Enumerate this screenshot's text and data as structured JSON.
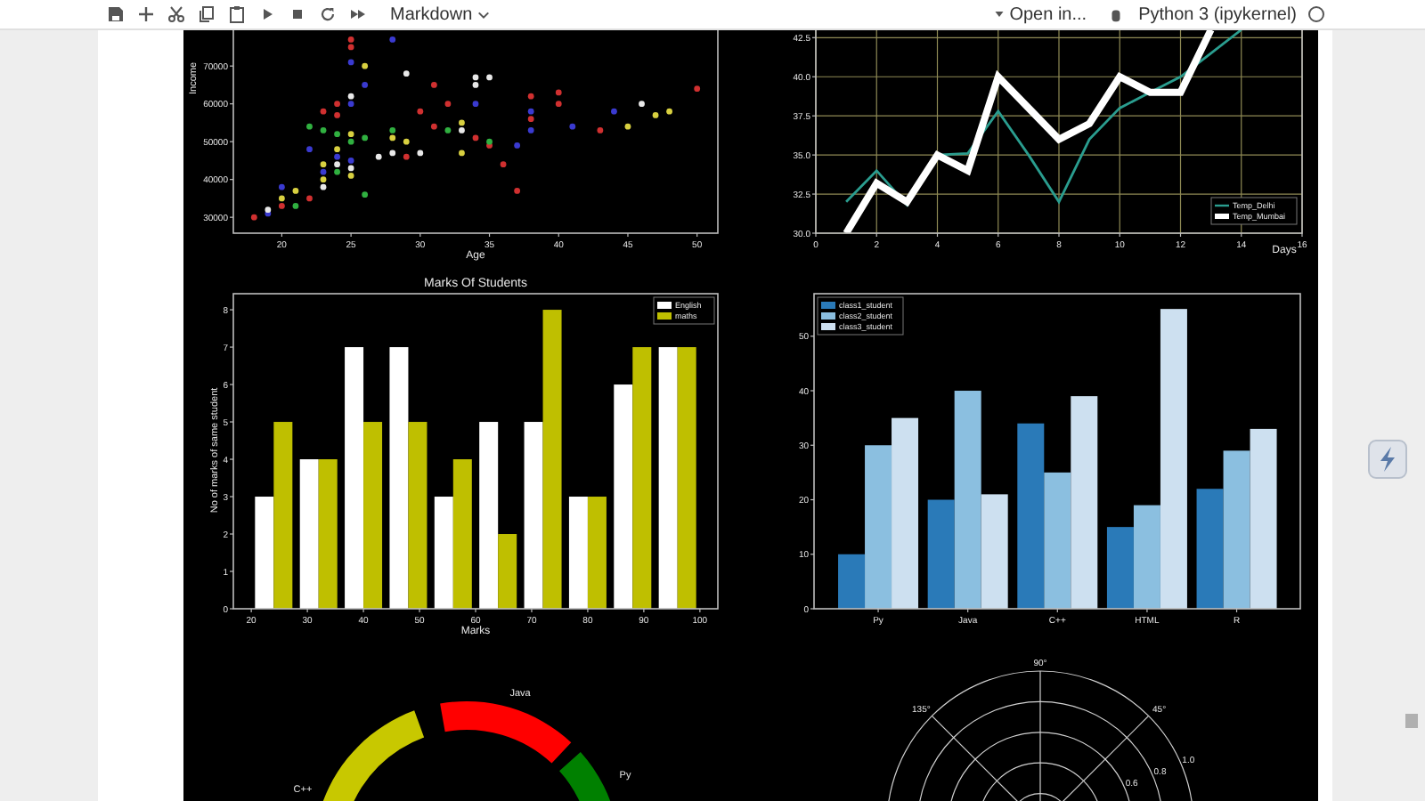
{
  "toolbar": {
    "cell_type": "Markdown",
    "open_in": "Open in...",
    "kernel": "Python 3 (ipykernel)",
    "kernel_busy": false
  },
  "output": {
    "scatter": {
      "chart_data": {
        "type": "scatter",
        "xlabel": "Age",
        "ylabel": "Income",
        "xlim": [
          16.5,
          51.5
        ],
        "ylim": [
          25800,
          80400
        ],
        "xticks": [
          20,
          25,
          30,
          35,
          40,
          45,
          50
        ],
        "yticks": [
          30000,
          40000,
          50000,
          60000,
          70000
        ],
        "series": [
          {
            "color": "#3a3ad0",
            "x": [
              19,
              20,
              22,
              23,
              24,
              25,
              25,
              26,
              28,
              34,
              37,
              38,
              38,
              41,
              44,
              25
            ],
            "values": [
              31000,
              38000,
              48000,
              42000,
              46000,
              60000,
              71000,
              65000,
              77000,
              60000,
              49000,
              53000,
              58000,
              54000,
              58000,
              45000
            ]
          },
          {
            "color": "#d03030",
            "x": [
              18,
              20,
              22,
              23,
              24,
              24,
              25,
              25,
              29,
              30,
              31,
              31,
              32,
              34,
              35,
              37,
              38,
              38,
              40,
              40,
              43,
              50,
              36
            ],
            "values": [
              30000,
              33000,
              35000,
              58000,
              57000,
              60000,
              75000,
              77000,
              46000,
              58000,
              65000,
              54000,
              60000,
              51000,
              49000,
              37000,
              56000,
              62000,
              60000,
              63000,
              53000,
              64000,
              44000
            ]
          },
          {
            "color": "#30b040",
            "x": [
              21,
              22,
              23,
              24,
              24,
              25,
              26,
              26,
              28,
              32,
              35
            ],
            "values": [
              33000,
              54000,
              53000,
              52000,
              42000,
              50000,
              36000,
              51000,
              53000,
              53000,
              50000
            ]
          },
          {
            "color": "#d8d040",
            "x": [
              20,
              21,
              23,
              23,
              24,
              25,
              25,
              26,
              28,
              29,
              33,
              33,
              45,
              47,
              48
            ],
            "values": [
              35000,
              37000,
              44000,
              40000,
              48000,
              52000,
              41000,
              70000,
              51000,
              50000,
              55000,
              47000,
              54000,
              57000,
              58000
            ]
          },
          {
            "color": "#e8e8e8",
            "x": [
              19,
              23,
              24,
              25,
              25,
              28,
              29,
              30,
              33,
              34,
              34,
              35,
              46,
              27
            ],
            "values": [
              32000,
              38000,
              44000,
              62000,
              43000,
              47000,
              68000,
              47000,
              53000,
              65000,
              67000,
              67000,
              60000,
              46000
            ]
          }
        ]
      }
    },
    "temperature": {
      "chart_data": {
        "type": "line",
        "xlabel": "Days",
        "grid": true,
        "legend": "lower right",
        "xlim": [
          0,
          16
        ],
        "ylim": [
          30,
          43.2
        ],
        "xticks": [
          0,
          2,
          4,
          6,
          8,
          10,
          12,
          14,
          16
        ],
        "yticks": [
          {
            "value": 30,
            "label": "30.0"
          },
          {
            "value": 32.5,
            "label": "32.5"
          },
          {
            "value": 35,
            "label": "35.0"
          },
          {
            "value": 37.5,
            "label": "37.5"
          },
          {
            "value": 40,
            "label": "40.0"
          },
          {
            "value": 42.5,
            "label": "42.5"
          }
        ],
        "x": [
          1,
          2,
          3,
          4,
          5,
          6,
          7,
          8,
          9,
          10,
          11,
          12,
          13,
          14
        ],
        "series": [
          {
            "name": "Temp_Delhi",
            "color": "#2a9d8f",
            "values": [
              32,
              34,
              31.8,
              35,
              35.1,
              37.8,
              35,
              32,
              36,
              38,
              39,
              40,
              41.5,
              43
            ]
          },
          {
            "name": "Temp_Mumbai",
            "color": "#ffffff",
            "values": [
              30,
              33.2,
              32,
              35,
              34,
              40,
              38,
              36,
              37,
              40,
              39,
              39,
              43,
              null
            ]
          }
        ]
      }
    },
    "marks": {
      "chart_data": {
        "type": "bar",
        "title": "Marks Of Students",
        "legend": "upper right",
        "xlim": [
          16.8,
          103.2
        ],
        "ylim": [
          0,
          8.43
        ],
        "xlabel": "Marks",
        "ylabel": "No of marks of same student",
        "x": [
          24,
          32,
          40,
          48,
          56,
          64,
          72,
          80,
          88,
          96
        ],
        "xticks": [
          20,
          30,
          40,
          50,
          60,
          70,
          80,
          90,
          100
        ],
        "yticks": [
          0,
          1,
          2,
          3,
          4,
          5,
          6,
          7,
          8
        ],
        "series": [
          {
            "name": "English",
            "color": "#ffffff",
            "values": [
              3,
              4,
              7,
              7,
              3,
              5,
              5,
              3,
              6,
              7
            ]
          },
          {
            "name": "maths",
            "color": "#bfbf00",
            "values": [
              5,
              4,
              5,
              5,
              4,
              2,
              8,
              3,
              7,
              7
            ]
          }
        ]
      }
    },
    "classes": {
      "chart_data": {
        "type": "bar",
        "legend": "upper left",
        "ylim": [
          0,
          57.8
        ],
        "categories": [
          "Py",
          "Java",
          "C++",
          "HTML",
          "R"
        ],
        "yticks": [
          0,
          10,
          20,
          30,
          40,
          50
        ],
        "series": [
          {
            "name": "class1_student",
            "color": "#2a7ab8",
            "values": [
              10,
              20,
              34,
              15,
              22
            ]
          },
          {
            "name": "class2_student",
            "color": "#8bbfe0",
            "values": [
              30,
              40,
              25,
              19,
              29
            ]
          },
          {
            "name": "class3_student",
            "color": "#cde0f0",
            "values": [
              35,
              21,
              39,
              55,
              33
            ]
          }
        ]
      }
    },
    "ring": {
      "segments": [
        {
          "label": "Java",
          "color": "#ff0000"
        },
        {
          "label": "Py",
          "color": "#008000"
        },
        {
          "label": "C++",
          "color": "#c8c800"
        }
      ]
    },
    "polar": {
      "angle_labels": [
        "90°",
        "135°",
        "45°"
      ],
      "radial_labels": [
        "1.0",
        "0.8",
        "0.6"
      ]
    }
  }
}
